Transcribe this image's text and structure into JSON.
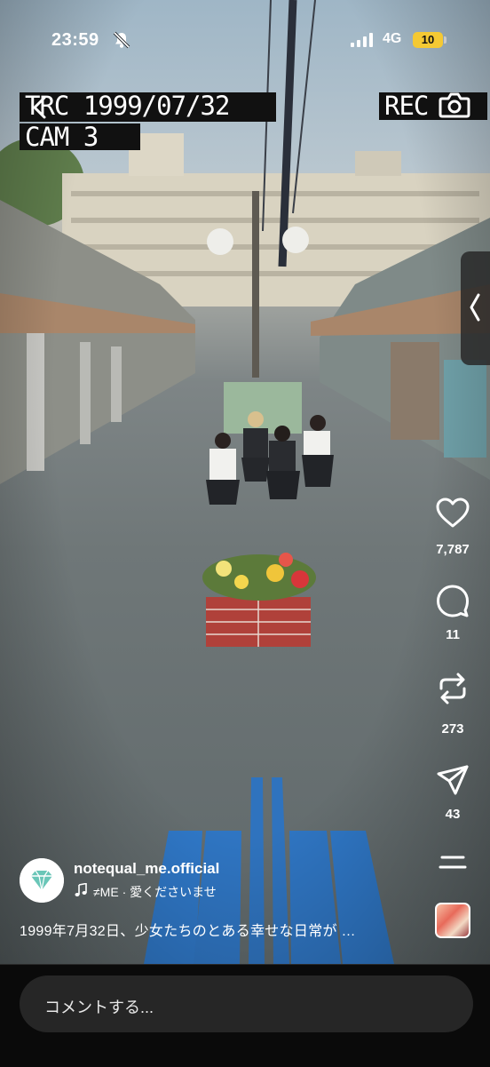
{
  "status_bar": {
    "time": "23:59",
    "network": "4G",
    "battery": "10",
    "icons": [
      "bell-slash-icon",
      "signal-icon"
    ]
  },
  "overlay": {
    "date_text": "TRC 1999/07/32",
    "cam_text": "CAM 3",
    "rec_text": "REC",
    "icons": [
      "back-arrow-icon",
      "camera-icon",
      "chevron-left-icon"
    ]
  },
  "actions": {
    "likes": "7,787",
    "comments": "11",
    "reposts": "273",
    "shares": "43",
    "icons": [
      "heart-icon",
      "comment-icon",
      "repost-icon",
      "share-icon",
      "menu-icon"
    ]
  },
  "post": {
    "account": "notequal_me.official",
    "audio": "≠ME · 愛くださいませ",
    "caption": "1999年7月32日、少女たちのとある幸せな日常が …"
  },
  "comment_bar": {
    "placeholder": "コメントする..."
  },
  "colors": {
    "battery": "#f5c933",
    "background": "#000000",
    "comment_field": "#262626"
  }
}
